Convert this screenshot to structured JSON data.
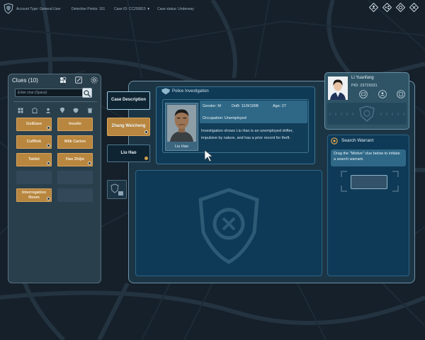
{
  "top_bar": {
    "account_type": "Account Type: General User",
    "detective_points": "Detective Points: 101",
    "case_id": "Case ID: CC250815 ▼",
    "case_status": "Case status: Underway",
    "icons": [
      "profile-icon",
      "network-icon",
      "settings-icon",
      "exit-icon"
    ]
  },
  "clues": {
    "title": "Clues  (10)",
    "search_placeholder": "Enter clue (Space)",
    "header_icons": [
      "add-icon",
      "edit-icon",
      "gear-icon"
    ],
    "filter_icons": [
      "grid-icon",
      "building-icon",
      "person-icon",
      "location-icon",
      "shield-icon",
      "trash-icon"
    ],
    "cards": [
      {
        "label": "GutEase"
      },
      {
        "label": "Insulin"
      },
      {
        "label": "Cufflink"
      },
      {
        "label": "Milk Carton"
      },
      {
        "label": "Tablet"
      },
      {
        "label": "Hao Zhijie"
      },
      {
        "label": "Interrogation Room"
      }
    ]
  },
  "tabs": [
    {
      "label": "Case Description",
      "state": "active"
    },
    {
      "label": "Zhang Weicheng",
      "state": "gold"
    },
    {
      "label": "Liu Hao",
      "state": "normal"
    }
  ],
  "investigation": {
    "title": "Police Investigation",
    "photo_name": "Liu Hao",
    "gender": "Gender: M",
    "dob": "DoB: 11/9/1998",
    "age": "Age: 27",
    "occupation": "Occupation: Unemployed",
    "description": "Investigation shows Liu Hao is an unemployed drifter, impulsive by nature, and has a prior record for theft."
  },
  "officer": {
    "name": "Li Yuanfang",
    "pid": "PID: 23729331",
    "icons": [
      "message-icon",
      "user-icon",
      "database-icon"
    ]
  },
  "warrant": {
    "title": "Search Warrant",
    "hint": "Drag the \"Motive\" clue below to initiate a search warrant."
  },
  "colors": {
    "accent": "#6f93a8",
    "clue_gold": "#b8863f",
    "panel_blue": "#0e3a57",
    "info_blue": "#2f6887"
  }
}
